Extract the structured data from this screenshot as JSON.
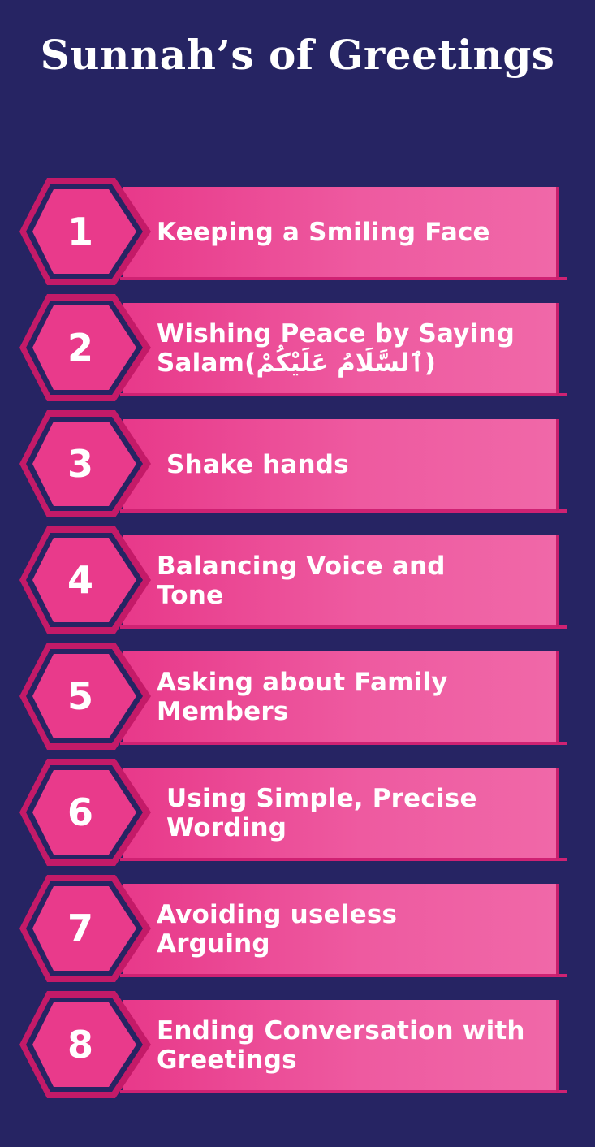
{
  "title": "Sunnah’s of Greetings",
  "colors": {
    "background": "#262463",
    "accent_pink": "#e8398a",
    "hexagon_fill": "#e93a8b",
    "hexagon_stroke": "#c41a68",
    "text": "#ffffff"
  },
  "items": [
    {
      "number": "1",
      "label": "Keeping a Smiling Face"
    },
    {
      "number": "2",
      "label": "Wishing Peace by Saying Salam(ٱلسَّلَامُ عَلَيْكُمْ)"
    },
    {
      "number": "3",
      "label": "Shake hands"
    },
    {
      "number": "4",
      "label": "Balancing Voice and Tone"
    },
    {
      "number": "5",
      "label": "Asking about Family Members"
    },
    {
      "number": "6",
      "label": "Using Simple, Precise Wording"
    },
    {
      "number": "7",
      "label": "Avoiding useless Arguing"
    },
    {
      "number": "8",
      "label": "Ending Conversation with Greetings"
    }
  ]
}
